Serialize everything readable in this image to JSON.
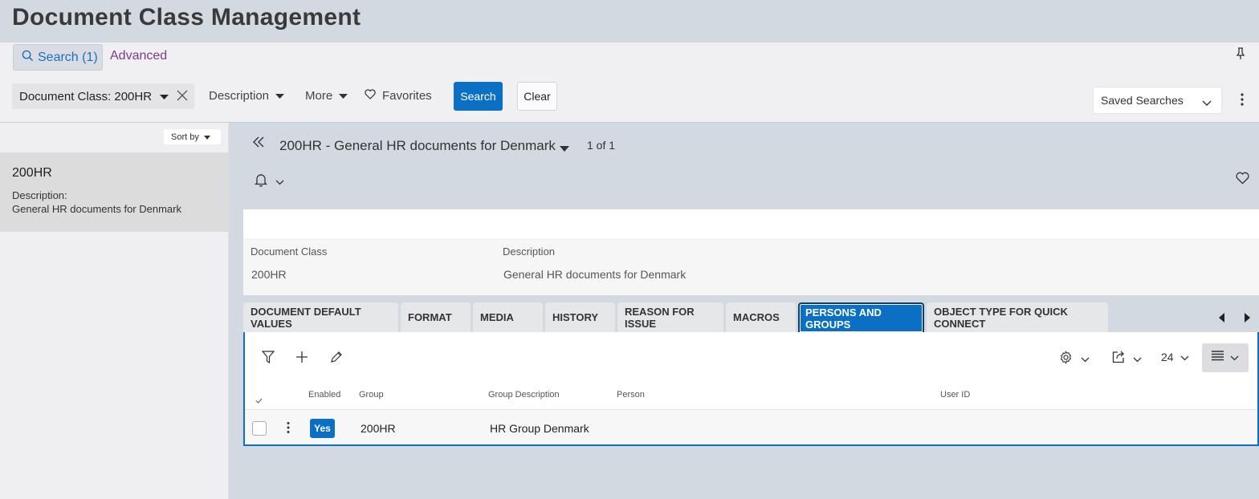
{
  "page": {
    "title": "Document Class Management"
  },
  "search_tabs": {
    "search_label": "Search (1)",
    "advanced_label": "Advanced"
  },
  "filters": {
    "chip_label": "Document Class: 200HR",
    "description_label": "Description",
    "more_label": "More",
    "favorites_label": "Favorites",
    "search_button": "Search",
    "clear_button": "Clear",
    "saved_searches": "Saved Searches"
  },
  "list": {
    "sort_label": "Sort by",
    "items": [
      {
        "title": "200HR",
        "desc_label": "Description:",
        "desc": "General HR documents for Denmark"
      }
    ]
  },
  "record": {
    "title": "200HR - General HR documents for Denmark",
    "count": "1 of 1",
    "fields": [
      {
        "label": "Document Class",
        "value": "200HR"
      },
      {
        "label": "Description",
        "value": "General HR documents for Denmark"
      }
    ]
  },
  "tabs": [
    {
      "label": "DOCUMENT DEFAULT VALUES",
      "active": false
    },
    {
      "label": "FORMAT",
      "active": false
    },
    {
      "label": "MEDIA",
      "active": false
    },
    {
      "label": "HISTORY",
      "active": false
    },
    {
      "label": "REASON FOR ISSUE",
      "active": false
    },
    {
      "label": "MACROS",
      "active": false
    },
    {
      "label": "PERSONS AND GROUPS",
      "active": true
    },
    {
      "label": "OBJECT TYPE FOR QUICK CONNECT",
      "active": false
    }
  ],
  "grid": {
    "page_size": "24",
    "columns": [
      "Enabled",
      "Group",
      "Group Description",
      "Person",
      "User ID"
    ],
    "rows": [
      {
        "enabled": "Yes",
        "group": "200HR",
        "group_description": "HR Group Denmark",
        "person": "",
        "user_id": ""
      }
    ]
  },
  "colors": {
    "accent": "#0b6fc4",
    "advanced_link": "#7a3d8a",
    "header_bg": "#d3d9e0"
  },
  "icons": [
    "search-icon",
    "pin-icon",
    "caret-down-icon",
    "close-icon",
    "heart-icon",
    "kebab-icon",
    "double-chevron-left-icon",
    "bell-icon",
    "chevron-down-icon",
    "chevron-left-icon",
    "chevron-right-icon",
    "filter-icon",
    "plus-icon",
    "pencil-icon",
    "gear-icon",
    "export-icon",
    "list-view-icon",
    "checkmark-icon"
  ]
}
